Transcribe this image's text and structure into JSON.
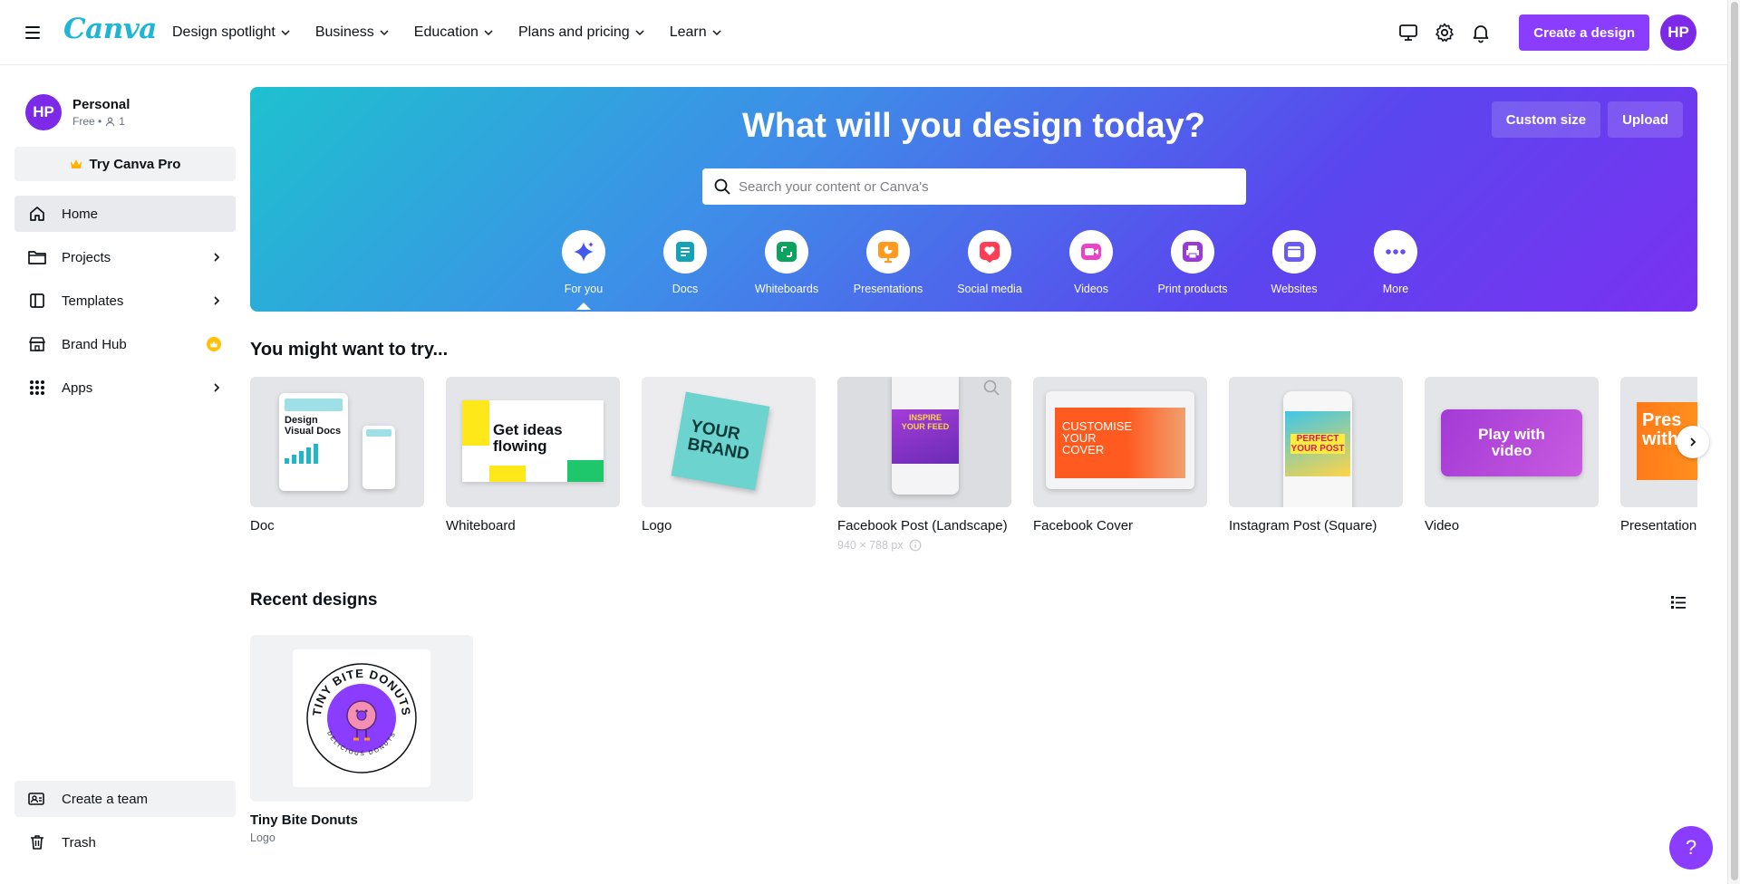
{
  "topbar": {
    "logo": "Canva",
    "nav": [
      "Design spotlight",
      "Business",
      "Education",
      "Plans and pricing",
      "Learn"
    ],
    "create_label": "Create a design",
    "avatar_initials": "HP"
  },
  "sidebar": {
    "profile": {
      "initials": "HP",
      "name": "Personal",
      "plan": "Free •",
      "members": "1"
    },
    "try_pro": "Try Canva Pro",
    "items": [
      {
        "label": "Home",
        "icon": "home-icon"
      },
      {
        "label": "Projects",
        "icon": "folder-icon"
      },
      {
        "label": "Templates",
        "icon": "templates-icon"
      },
      {
        "label": "Brand Hub",
        "icon": "brand-hub-icon"
      },
      {
        "label": "Apps",
        "icon": "apps-grid-icon"
      }
    ],
    "bottom_items": [
      {
        "label": "Create a team",
        "icon": "team-icon"
      },
      {
        "label": "Trash",
        "icon": "trash-icon"
      }
    ]
  },
  "hero": {
    "title": "What will you design today?",
    "custom_size": "Custom size",
    "upload": "Upload",
    "search_placeholder": "Search your content or Canva's",
    "categories": [
      "For you",
      "Docs",
      "Whiteboards",
      "Presentations",
      "Social media",
      "Videos",
      "Print products",
      "Websites",
      "More"
    ]
  },
  "suggestions": {
    "title": "You might want to try...",
    "tiles": [
      {
        "label": "Doc",
        "thumb_text": "Design Visual Docs"
      },
      {
        "label": "Whiteboard",
        "thumb_text": "Get ideas flowing"
      },
      {
        "label": "Logo",
        "thumb_text": "YOUR BRAND"
      },
      {
        "label": "Facebook Post (Landscape)",
        "thumb_text": "INSPIRE YOUR FEED",
        "sub": "940 × 788 px"
      },
      {
        "label": "Facebook Cover",
        "thumb_text": "CUSTOMISE YOUR COVER"
      },
      {
        "label": "Instagram Post (Square)",
        "thumb_text": "PERFECT YOUR POST"
      },
      {
        "label": "Video",
        "thumb_text": "Play with video"
      },
      {
        "label": "Presentation",
        "thumb_text": "Pres with"
      }
    ]
  },
  "recent": {
    "title": "Recent designs",
    "items": [
      {
        "title": "Tiny Bite Donuts",
        "type": "Logo",
        "ring_top": "TINY BITE DONUTS",
        "ring_bottom": "DELICIOUS DONUTS"
      }
    ]
  },
  "help_label": "?"
}
